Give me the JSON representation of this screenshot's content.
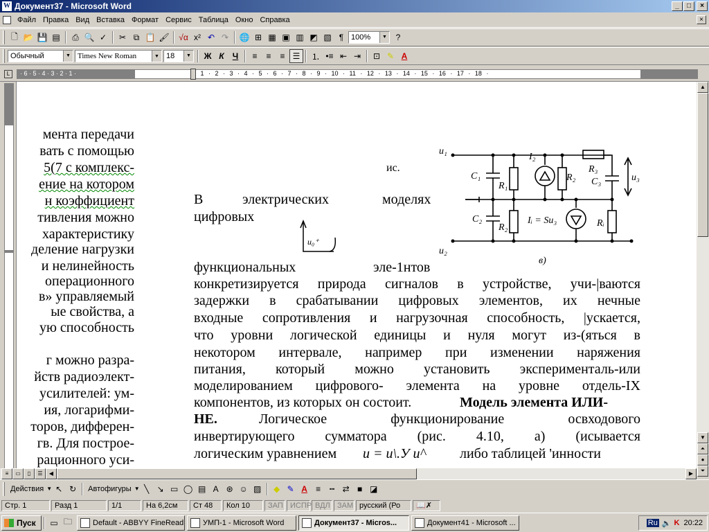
{
  "window": {
    "title": "Документ37 - Microsoft Word",
    "minimize": "_",
    "maximize": "□",
    "close": "×"
  },
  "menu": [
    "Файл",
    "Правка",
    "Вид",
    "Вставка",
    "Формат",
    "Сервис",
    "Таблица",
    "Окно",
    "Справка"
  ],
  "toolbar": {
    "zoom": "100%",
    "help": "?"
  },
  "format": {
    "style": "Обычный",
    "font": "Times New Roman",
    "size": "18",
    "bold": "Ж",
    "italic": "К",
    "underline": "Ч"
  },
  "ruler": {
    "ticks": "· 6 · 5 · 4 · 3 · 2 · 1 ·",
    "ticks2": "· 1 · 2 · 3 · 4 · 5 · 6 · 7 · 8 · 9 · 10 · 11 · 12 · 13 · 14 · 15 · 16 · 17 · 18 ·"
  },
  "left_column": [
    "мента передачи",
    "вать с помощью",
    "5(7 с комплекс-",
    "ение на котором",
    "н коэффициент",
    "тивления можно",
    "характеристику",
    "деление нагрузки",
    "и нелинейность",
    "операционного",
    "в» управляемый",
    "ые свойства, а",
    "ую способность",
    "г можно разра-",
    "йств радиоэлект-",
    "усилителей: ум-",
    "ия, логарифми-",
    "торов, дифферен-",
    "гв. Для построе-",
    "рационного уси-"
  ],
  "figure": {
    "caption": "ис.",
    "label_b": "в)",
    "u1": "u₁",
    "u2": "u₂",
    "C1": "C₁",
    "C2": "C₂",
    "C3": "C₃",
    "R1": "R₁",
    "R2": "R₂",
    "R3": "R₃",
    "Ri": "Rᵢ",
    "I2": "I₂",
    "u3": "u₃",
    "Ii": "Iᵢ = Su₃",
    "small_axis": "u₀⁺"
  },
  "main_text": {
    "l1a": "В",
    "l1b": "электрических",
    "l1c": "моделях",
    "l2": "цифровых",
    "l3a": "функциональных",
    "l3b": "эле-1нтов",
    "lines": [
      "конкретизируется природа сигналов в устройстве, учи-|ваются",
      "задержки в срабатывании цифровых элементов, их нечные",
      "входные сопротивления и нагрузочная способность, |ускается,",
      "что уровни логической единицы и нуля могут из-(яться в",
      "некотором интервале, например при изменении наряжения",
      "питания, который можно установить эксперименталь-или",
      "моделированием цифрового- элемента на уровне отдель-IX"
    ],
    "l11a": "компонентов, из которых он состоит.",
    "l11b": "Модель элемента ИЛИ-",
    "l12a": "НЕ.",
    "l12b": "Логическое функционирование освходового",
    "l13": "инвертирующего сумматора (рис. 4.10, а) (исывается",
    "l14a": "логическим уравнением",
    "l14b": "u = u\\.У u^",
    "l14c": "либо таблицей 'инности"
  },
  "drawing": {
    "actions": "Действия",
    "autoshapes": "Автофигуры"
  },
  "status": {
    "page": "Стр. 1",
    "section": "Разд 1",
    "pages": "1/1",
    "at": "На 6,2см",
    "line": "Ст 48",
    "col": "Кол 10",
    "rec": "ЗАП",
    "trk": "ИСПР",
    "ext": "ВДЛ",
    "ovr": "ЗАМ",
    "lang": "русский (Ро"
  },
  "taskbar": {
    "start": "Пуск",
    "tasks": [
      "Default - ABBYY FineRead...",
      "УМП-1 - Microsoft Word",
      "Документ37 - Micros...",
      "Документ41 - Microsoft ..."
    ],
    "lang": "Ru",
    "time": "20:22"
  }
}
